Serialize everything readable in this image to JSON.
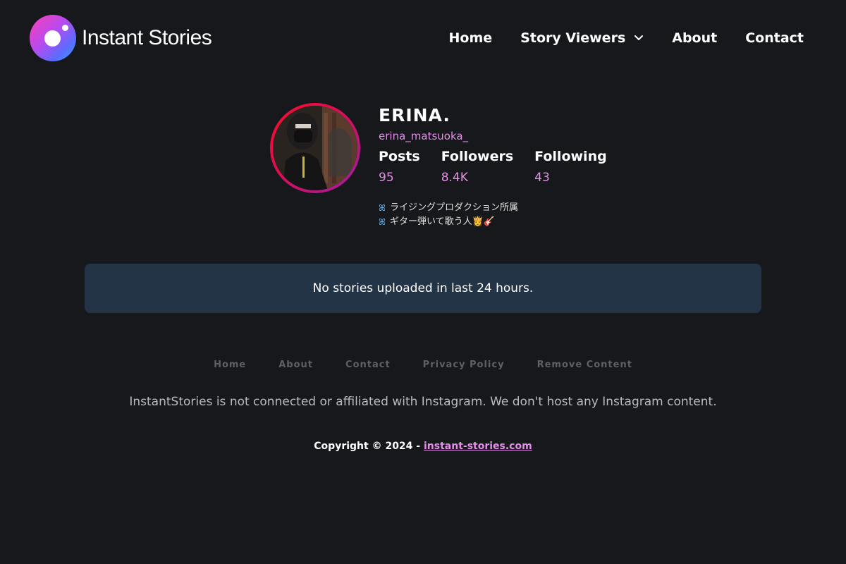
{
  "brand": {
    "name": "Instant Stories",
    "gradient": [
      "#ff3fb4",
      "#b44bf0",
      "#5b6cff",
      "#3aa0ff"
    ]
  },
  "nav": {
    "items": [
      {
        "label": "Home"
      },
      {
        "label": "Story Viewers",
        "has_dropdown": true
      },
      {
        "label": "About"
      },
      {
        "label": "Contact"
      }
    ]
  },
  "profile": {
    "full_name": "ERINA.",
    "username": "erina_matsuoka_",
    "stats": [
      {
        "label": "Posts",
        "value": "95"
      },
      {
        "label": "Followers",
        "value": "8.4K"
      },
      {
        "label": "Following",
        "value": "43"
      }
    ],
    "bio": [
      {
        "icon": "butterfly-icon",
        "text": "ライジングプロダクション所属"
      },
      {
        "icon": "butterfly-icon",
        "text": "ギター弾いて歌う人👸🎸"
      }
    ],
    "ring_colors": [
      "#ff0a2a",
      "#9b1fa8"
    ]
  },
  "notice": {
    "text": "No stories uploaded in last 24 hours."
  },
  "footer": {
    "links": [
      "Home",
      "About",
      "Contact",
      "Privacy Policy",
      "Remove Content"
    ],
    "disclaimer": "InstantStories is not connected or affiliated with Instagram. We don't host any Instagram content.",
    "copyright_prefix": "Copyright © 2024 -",
    "copyright_link": "instant-stories.com"
  },
  "colors": {
    "background": "#16181b",
    "accent": "#e48ee9",
    "notice_bg": "#243447"
  }
}
